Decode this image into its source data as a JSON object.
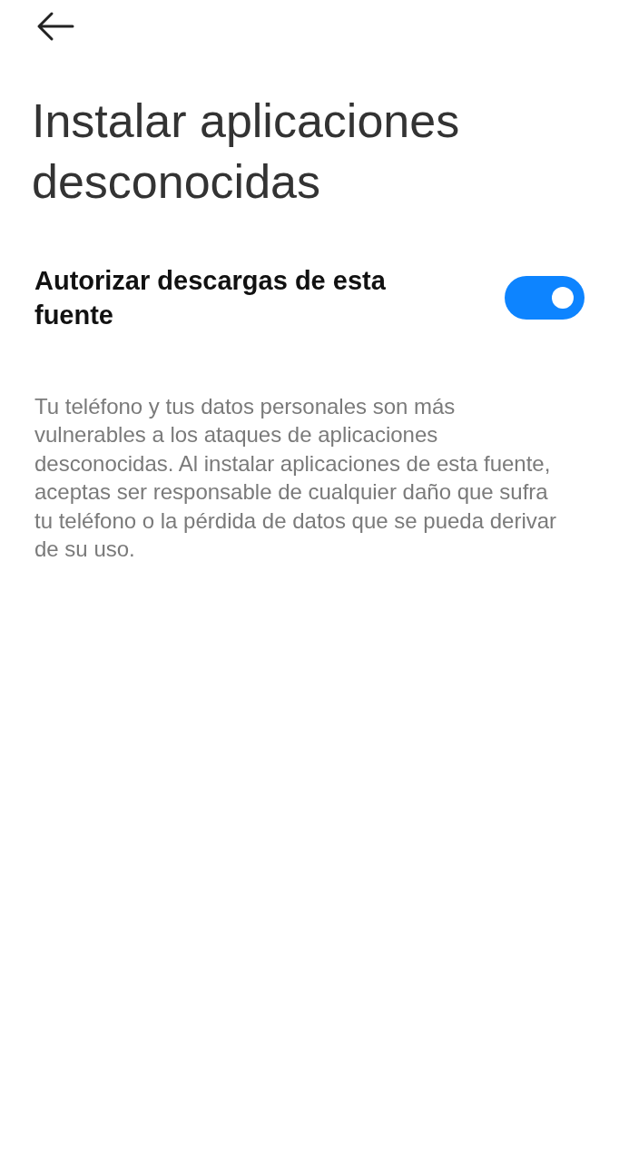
{
  "header": {
    "title": "Instalar aplicaciones desconocidas"
  },
  "setting": {
    "label": "Autorizar descargas de esta fuente",
    "on": true
  },
  "description": "Tu teléfono y tus datos personales son más vulnerables a los ataques de aplicaciones desconocidas. Al instalar aplicaciones de esta fuente, aceptas ser responsable de cualquier daño que sufra tu teléfono o la pérdida de datos que se pueda derivar de su uso."
}
